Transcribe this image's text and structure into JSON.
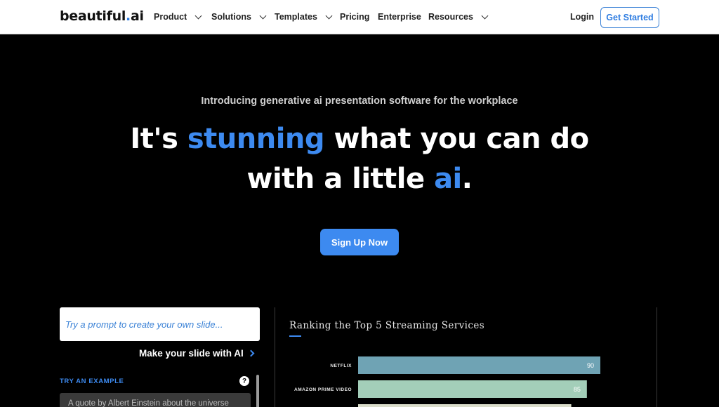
{
  "nav": {
    "logo_main": "beautiful",
    "logo_dot": ".",
    "logo_suffix": "ai",
    "items": [
      {
        "label": "Product",
        "dropdown": true
      },
      {
        "label": "Solutions",
        "dropdown": true
      },
      {
        "label": "Templates",
        "dropdown": true
      },
      {
        "label": "Pricing",
        "dropdown": false
      },
      {
        "label": "Enterprise",
        "dropdown": false
      },
      {
        "label": "Resources",
        "dropdown": true
      }
    ],
    "login": "Login",
    "cta": "Get Started"
  },
  "hero": {
    "intro": "Introducing generative ai presentation software for the workplace",
    "headline_part1": "It's ",
    "headline_highlight1": "stunning",
    "headline_part2": " what you can do",
    "headline_part3": "with a little ",
    "headline_highlight2": "ai",
    "headline_part4": ".",
    "signup": "Sign Up Now"
  },
  "prompt_panel": {
    "placeholder": "Try a prompt to create your own slide...",
    "make_slide": "Make your slide with AI",
    "try_example": "TRY AN EXAMPLE",
    "help_icon": "?",
    "example": "A quote by Albert Einstein about the universe"
  },
  "colors": {
    "accent": "#3d8af0",
    "bar_1": "#6fa3b4",
    "bar_2": "#a3ceb9",
    "bar_3": "#d9dcc9"
  },
  "chart_data": {
    "type": "bar",
    "orientation": "horizontal",
    "title": "Ranking the Top 5 Streaming Services",
    "categories": [
      "NETFLIX",
      "AMAZON PRIME VIDEO",
      ""
    ],
    "values": [
      90,
      85,
      null
    ],
    "xlim": [
      0,
      90
    ]
  }
}
